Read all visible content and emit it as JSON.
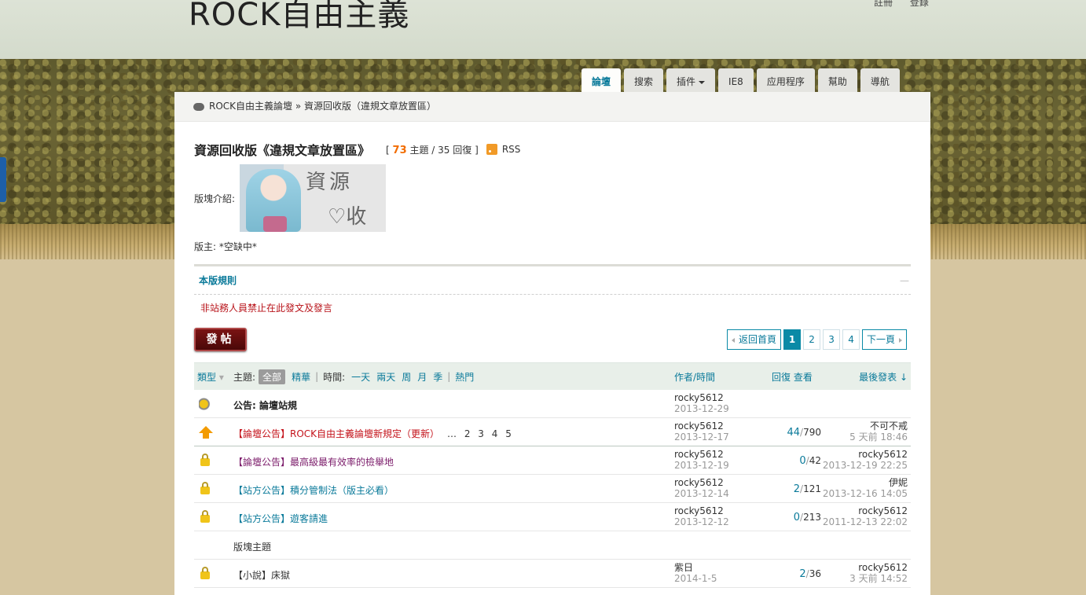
{
  "site": {
    "logo": "ROCK自由主義",
    "top_links": [
      "註冊",
      "登錄"
    ]
  },
  "nav": {
    "tabs": [
      {
        "label": "論壇",
        "active": true
      },
      {
        "label": "搜索",
        "active": false
      },
      {
        "label": "插件",
        "active": false,
        "dropdown": true
      },
      {
        "label": "IE8",
        "active": false
      },
      {
        "label": "应用程序",
        "active": false
      },
      {
        "label": "幫助",
        "active": false
      },
      {
        "label": "導航",
        "active": false
      }
    ]
  },
  "breadcrumb": {
    "home": "ROCK自由主義論壇",
    "separator": "»",
    "current": "資源回收版（違規文章放置區）"
  },
  "forum": {
    "title": "資源回收版《違規文章放置區》",
    "open_bracket": "[",
    "topics_count": "73",
    "topics_label": "主題",
    "slash": "/",
    "replies_count": "35",
    "replies_label": "回復",
    "close_bracket": "]",
    "rss_label": "RSS",
    "intro_label": "版塊介紹:",
    "banner_text_1": "資源",
    "banner_text_2": "♡收",
    "moderator": "版主: *空缺中*"
  },
  "rules": {
    "title": "本版規則",
    "collapse": "—",
    "text": "非站務人員禁止在此發文及發言"
  },
  "actions": {
    "post_button": "發帖"
  },
  "pager": {
    "back": "返回首頁",
    "pages": [
      "1",
      "2",
      "3",
      "4"
    ],
    "current_page": "1",
    "next": "下一頁"
  },
  "table_header": {
    "type": "類型",
    "topic": "主題:",
    "all": "全部",
    "digest": "精華",
    "time": "時間:",
    "time_filters": [
      "一天",
      "兩天",
      "周",
      "月",
      "季"
    ],
    "hot": "熱門",
    "author_time": "作者/時間",
    "replies_views": "回復 查看",
    "last_post": "最後發表"
  },
  "threads": [
    {
      "icon": "announcement",
      "title": "公告: 論壇站規",
      "style": "bold",
      "author": "rocky5612",
      "date": "2013-12-29",
      "replies": "",
      "views": "",
      "last_user": "",
      "last_time": ""
    },
    {
      "icon": "sticky-global",
      "title": "【論壇公告】ROCK自由主義論壇新規定（更新）",
      "pages": "… 2 3 4 5",
      "style": "red",
      "author": "rocky5612",
      "date": "2013-12-17",
      "replies": "44",
      "views": "790",
      "last_user": "不可不戒",
      "last_time": "5 天前 18:46"
    },
    {
      "icon": "lock",
      "title": "【論壇公告】最高級最有效率的檢舉地",
      "style": "purple",
      "author": "rocky5612",
      "date": "2013-12-19",
      "replies": "0",
      "views": "42",
      "last_user": "rocky5612",
      "last_time": "2013-12-19 22:25"
    },
    {
      "icon": "lock",
      "title": "【站方公告】積分管制法（版主必看）",
      "style": "teal",
      "author": "rocky5612",
      "date": "2013-12-14",
      "replies": "2",
      "views": "121",
      "last_user": "伊妮",
      "last_time": "2013-12-16 14:05"
    },
    {
      "icon": "lock",
      "title": "【站方公告】遊客請進",
      "style": "teal",
      "author": "rocky5612",
      "date": "2013-12-12",
      "replies": "0",
      "views": "213",
      "last_user": "rocky5612",
      "last_time": "2011-12-13 22:02"
    }
  ],
  "section_label": "版塊主題",
  "normal_threads": [
    {
      "icon": "lock",
      "title": "【小說】床獄",
      "style": "dark",
      "author": "紫日",
      "date": "2014-1-5",
      "replies": "2",
      "views": "36",
      "last_user": "rocky5612",
      "last_time": "3 天前 14:52"
    }
  ]
}
